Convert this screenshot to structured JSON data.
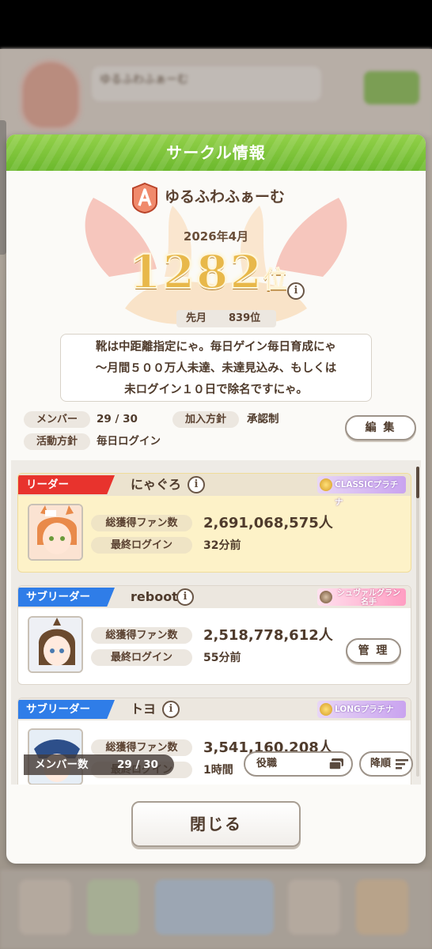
{
  "background": {
    "circle_name": "ゆるふわふぁーむ"
  },
  "dialog": {
    "title": "サークル情報",
    "circle_name": "ゆるふわふぁーむ",
    "rank_month": "2026年4月",
    "rank_number": "1282",
    "rank_suffix": "位",
    "info_glyph": "i",
    "last_month_label": "先月",
    "last_month_value": "839位",
    "description_lines": [
      "靴は中距離指定にゃ。毎日ゲイン毎日育成にゃ",
      "～月間５００万人未達、未達見込み、もしくは",
      "未ログイン１０日で除名ですにゃ。"
    ],
    "members_label": "メンバー",
    "members_value": "29 / 30",
    "join_policy_label": "加入方針",
    "join_policy_value": "承認制",
    "activity_label": "活動方針",
    "activity_value": "毎日ログイン",
    "edit_button": "編 集",
    "close_button": "閉じる"
  },
  "members": [
    {
      "role": "リーダー",
      "name": "にゃぐろ",
      "title_badge": "CLASSICプラチナ",
      "fans_label": "総獲得ファン数",
      "fans_value": "2,691,068,575人",
      "login_label": "最終ログイン",
      "login_value": "32分前"
    },
    {
      "role": "サブリーダー",
      "name": "reboot",
      "title_badge_line1": "シュヴァルグラン",
      "title_badge_line2": "名手",
      "fans_label": "総獲得ファン数",
      "fans_value": "2,518,778,612人",
      "login_label": "最終ログイン",
      "login_value": "55分前",
      "manage_button": "管 理"
    },
    {
      "role": "サブリーダー",
      "name": "トヨ",
      "title_badge": "LONGプラチナ",
      "fans_label": "総獲得ファン数",
      "fans_value": "3,541,160,208人",
      "login_label": "最終ログイン",
      "login_value": "1時間"
    }
  ],
  "list_footer": {
    "count_label": "メンバー数",
    "count_value": "29 / 30",
    "sort_label": "役職",
    "order_label": "降順"
  },
  "colors": {
    "header_green": "#7cc23a",
    "leader_red": "#e8332d",
    "subleader_blue": "#2f7de8",
    "rank_gold": "#e8b84a"
  }
}
